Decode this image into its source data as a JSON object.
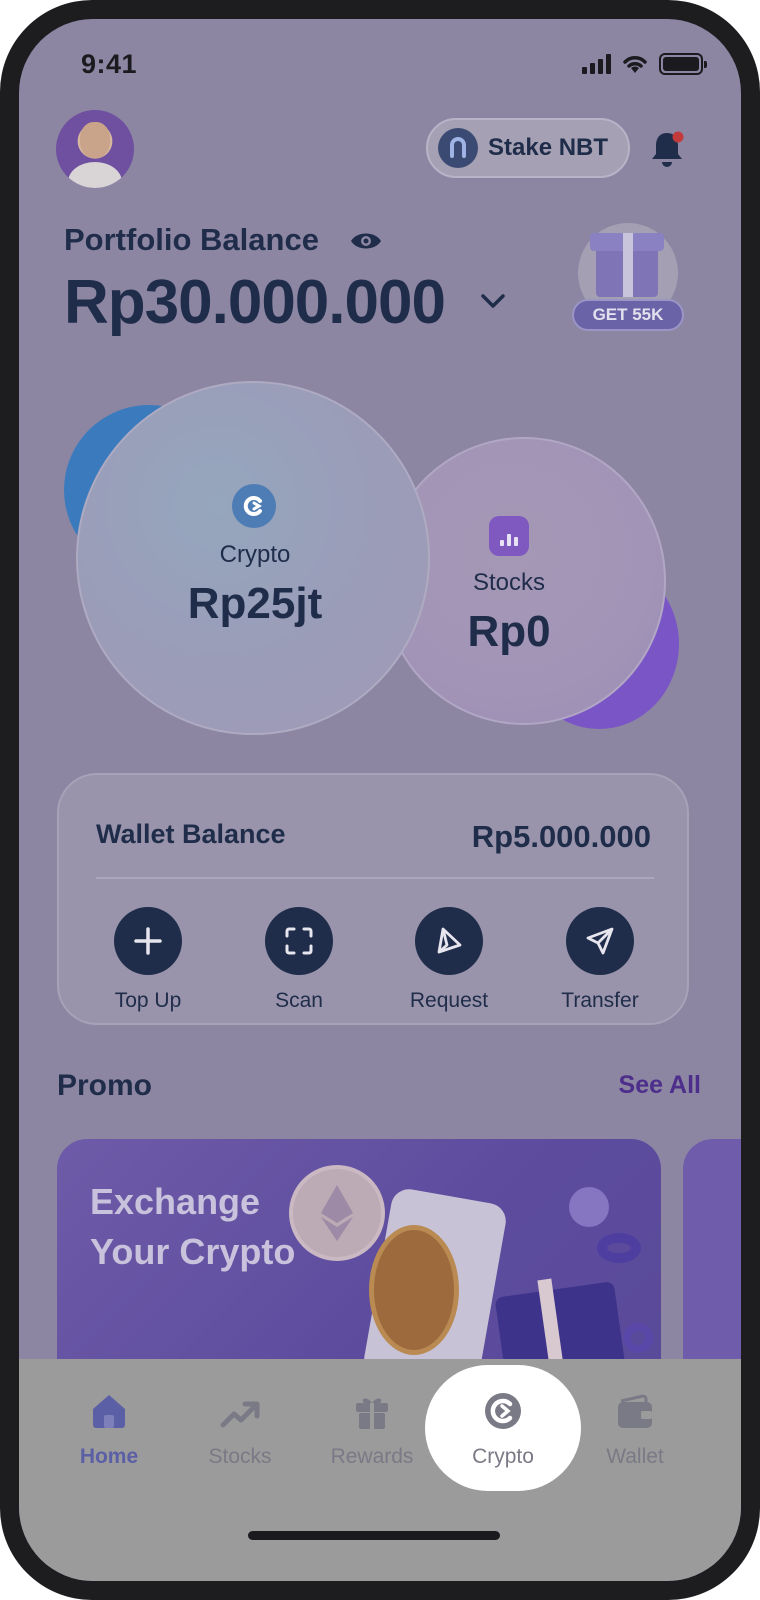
{
  "status_bar": {
    "time": "9:41"
  },
  "header": {
    "stake_label": "Stake NBT"
  },
  "portfolio": {
    "label": "Portfolio Balance",
    "value": "Rp30.000.000",
    "reward_badge": "GET 55K"
  },
  "assets": {
    "crypto": {
      "label": "Crypto",
      "value": "Rp25jt"
    },
    "stocks": {
      "label": "Stocks",
      "value": "Rp0"
    }
  },
  "wallet": {
    "title": "Wallet Balance",
    "amount": "Rp5.000.000",
    "actions": [
      {
        "label": "Top Up",
        "icon": "plus-icon"
      },
      {
        "label": "Scan",
        "icon": "scan-icon"
      },
      {
        "label": "Request",
        "icon": "request-icon"
      },
      {
        "label": "Transfer",
        "icon": "send-icon"
      }
    ]
  },
  "promo": {
    "title": "Promo",
    "see_all": "See All",
    "banner_text": "Exchange Your Crypto"
  },
  "tabbar": {
    "tabs": [
      {
        "label": "Home",
        "icon": "home-icon"
      },
      {
        "label": "Stocks",
        "icon": "trending-up-icon"
      },
      {
        "label": "Rewards",
        "icon": "gift-icon"
      },
      {
        "label": "Crypto",
        "icon": "crypto-icon"
      },
      {
        "label": "Wallet",
        "icon": "wallet-icon"
      }
    ],
    "active": "Home",
    "highlighted": "Crypto"
  },
  "colors": {
    "navy": "#1f2d4a",
    "accent_purple": "#4d2e8b",
    "active_tab": "#5b5fa6",
    "overlay": "#8c86a3"
  }
}
